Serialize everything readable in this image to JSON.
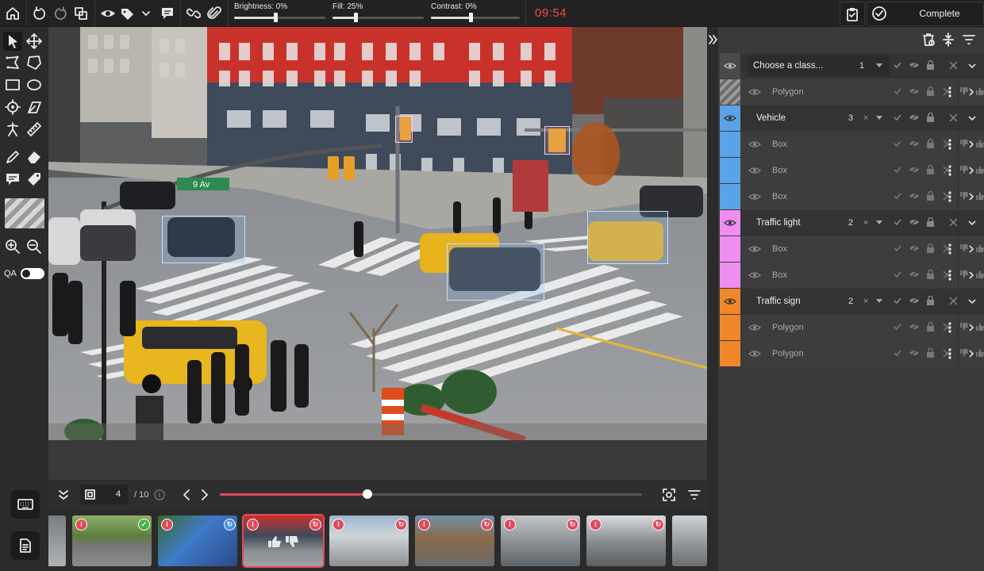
{
  "topbar": {
    "brightness_label": "Brightness: 0%",
    "brightness_value": 0.45,
    "fill_label": "Fill: 25%",
    "fill_value": 0.25,
    "contrast_label": "Contrast: 0%",
    "contrast_value": 0.45,
    "timer": "09:54",
    "complete_label": "Complete"
  },
  "canvas": {
    "street_sign": "9 Av"
  },
  "left_toolbar": {
    "qa_label": "QA"
  },
  "classes": {
    "choose_placeholder": "Choose a class...",
    "choose_count": "1",
    "choose_item": "Polygon",
    "groups": [
      {
        "name": "Vehicle",
        "count": "3",
        "color": "#5aa3e8",
        "items": [
          "Box",
          "Box",
          "Box"
        ]
      },
      {
        "name": "Traffic light",
        "count": "2",
        "color": "#ef8ef0",
        "items": [
          "Box",
          "Box"
        ]
      },
      {
        "name": "Traffic sign",
        "count": "2",
        "color": "#f0882b",
        "items": [
          "Polygon",
          "Polygon"
        ]
      }
    ]
  },
  "player": {
    "frame": "4",
    "total": "/ 10",
    "progress": 0.35
  },
  "colors": {
    "accent_red": "#e14a5c",
    "timer_red": "#ef4a52"
  }
}
